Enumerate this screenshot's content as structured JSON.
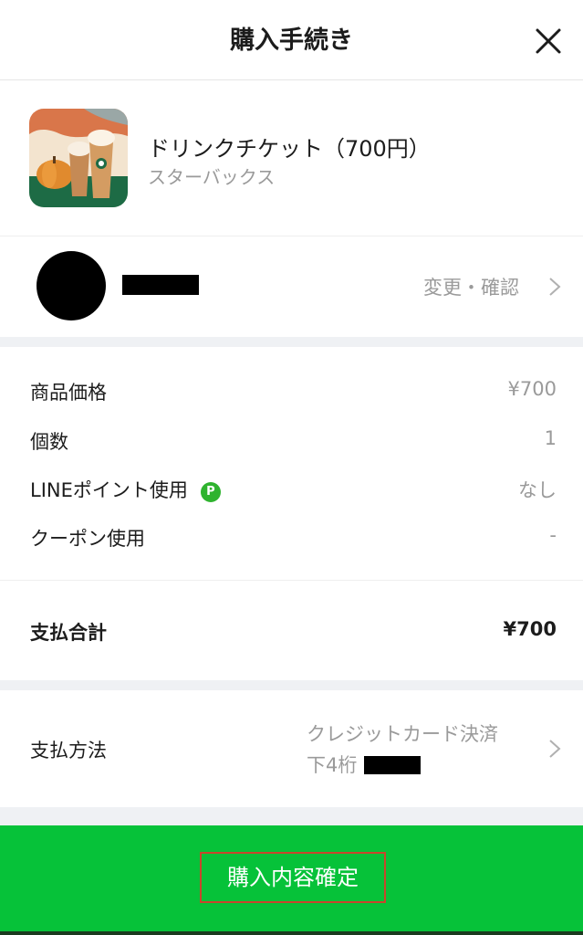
{
  "header": {
    "title": "購入手続き",
    "close_icon": "close-icon"
  },
  "product": {
    "name": "ドリンクチケット（700円）",
    "brand": "スターバックス",
    "thumbnail_icon": "drink-ticket-image"
  },
  "recipient": {
    "change_label": "変更・確認",
    "chevron_icon": "chevron-right-icon"
  },
  "breakdown": {
    "rows": [
      {
        "label": "商品価格",
        "value": "¥700"
      },
      {
        "label": "個数",
        "value": "1"
      },
      {
        "label": "LINEポイント使用",
        "value": "なし",
        "badge": "P"
      },
      {
        "label": "クーポン使用",
        "value": "-"
      }
    ]
  },
  "total": {
    "label": "支払合計",
    "value": "¥700"
  },
  "payment": {
    "label": "支払方法",
    "method": "クレジットカード決済",
    "card_prefix": "下4桁"
  },
  "confirm": {
    "label": "購入内容確定"
  },
  "colors": {
    "accent_green": "#06c239",
    "point_badge": "#2fb32f",
    "section_gap": "#eff1f4",
    "highlight_border": "#c8462c"
  }
}
